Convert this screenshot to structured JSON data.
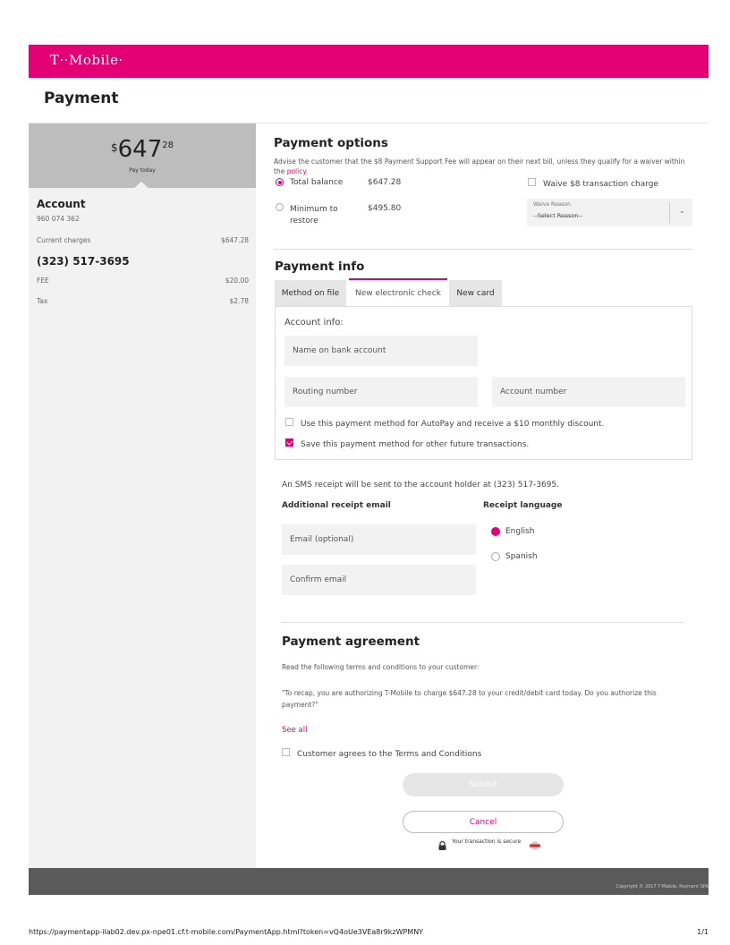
{
  "header": {
    "logo_text": "T··Mobile·",
    "brand_color": "#e20074"
  },
  "page": {
    "title": "Payment"
  },
  "summary": {
    "currency": "$",
    "amount_dollars": "647",
    "amount_cents": "28",
    "pay_today": "Pay today"
  },
  "account": {
    "heading": "Account",
    "number": "960 074 362",
    "current_charges_label": "Current charges",
    "current_charges_value": "$647.28",
    "phone": "(323) 517-3695",
    "lines": [
      {
        "label": "FEE",
        "value": "$20.00"
      },
      {
        "label": "Tax",
        "value": "$2.78"
      }
    ]
  },
  "payment_options": {
    "heading": "Payment options",
    "advice": "Advise the customer that the $8 Payment Support Fee will appear on their next bill, unless they qualify for a waiver within the",
    "policy_link": "policy.",
    "total_balance_label": "Total balance",
    "total_balance_value": "$647.28",
    "minimum_label": "Minimum to restore",
    "minimum_value": "$495.80",
    "waive_label": "Waive $8 transaction charge",
    "waive_reason_label": "Waive Reason",
    "waive_reason_value": "--Select Reason--",
    "selected": "total_balance"
  },
  "payment_info": {
    "heading": "Payment info",
    "tabs": [
      "Method on file",
      "New electronic check",
      "New card"
    ],
    "active_tab": "New electronic check",
    "account_info_label": "Account info:",
    "name_placeholder": "Name on bank account",
    "routing_placeholder": "Routing number",
    "account_placeholder": "Account number",
    "autopay_label": "Use this payment method for AutoPay and receive a $10 monthly discount.",
    "autopay_checked": false,
    "save_label": "Save this payment method for other future transactions.",
    "save_checked": true
  },
  "receipt": {
    "sms_notice": "An SMS receipt will be sent to the account holder at (323) 517-3695.",
    "additional_email_heading": "Additional receipt email",
    "email_placeholder": "Email (optional)",
    "confirm_placeholder": "Confirm email",
    "language_heading": "Receipt language",
    "languages": [
      "English",
      "Spanish"
    ],
    "selected_language": "English"
  },
  "agreement": {
    "heading": "Payment agreement",
    "instruction": "Read the following terms and conditions to your customer:",
    "quote": "\"To recap, you are authorizing T-Mobile to charge $647.28 to your credit/debit card today. Do you authorize this payment?\"",
    "see_all": "See all",
    "terms_label": "Customer agrees to the Terms and Conditions",
    "terms_checked": false,
    "submit_label": "Submit",
    "cancel_label": "Cancel",
    "secure_text": "Your transaction is secure"
  },
  "footer": {
    "copyright": "Copyright © 2017 T-Mobile, Payment SPA"
  },
  "print": {
    "url": "https://paymentapp-ilab02.dev.px-npe01.cf.t-mobile.com/PaymentApp.html?token=vQ4oUe3VEa8r9kzWPMNY",
    "page_number": "1/1"
  }
}
